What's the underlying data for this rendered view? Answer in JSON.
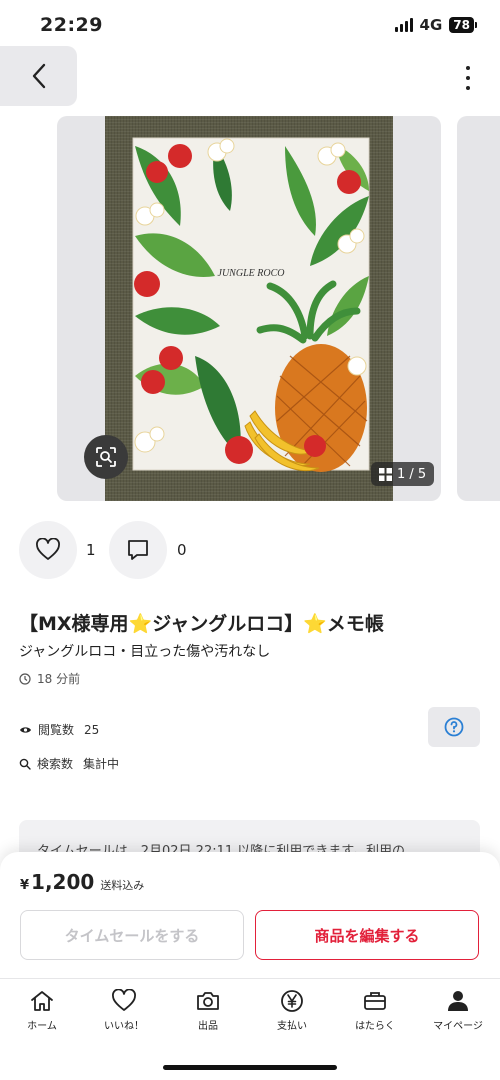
{
  "status_bar": {
    "time": "22:29",
    "network": "4G",
    "battery": "78"
  },
  "carousel": {
    "counter": "1 / 5",
    "photo_text": "JUNGLE ROCO"
  },
  "actions": {
    "like_count": "1",
    "comment_count": "0"
  },
  "item": {
    "title": "【MX様専用⭐️ジャングルロコ】⭐️メモ帳",
    "subtitle": "ジャングルロコ・目立った傷や汚れなし",
    "posted": "18 分前",
    "views_label": "閲覧数",
    "views_value": "25",
    "search_label": "検索数",
    "search_value": "集計中"
  },
  "notice": {
    "text": "タイムセールは、2月02日 22:11 以降に利用できます。利用の"
  },
  "purchase": {
    "currency": "¥",
    "price": "1,200",
    "shipping": "送料込み",
    "timesale_label": "タイムセールをする",
    "edit_label": "商品を編集する"
  },
  "tabs": [
    {
      "label": "ホーム",
      "icon": "home-icon"
    },
    {
      "label": "いいね！",
      "icon": "heart-icon"
    },
    {
      "label": "出品",
      "icon": "camera-icon"
    },
    {
      "label": "支払い",
      "icon": "yen-icon"
    },
    {
      "label": "はたらく",
      "icon": "briefcase-icon"
    },
    {
      "label": "マイページ",
      "icon": "person-icon"
    }
  ],
  "colors": {
    "accent": "#e2203a",
    "help": "#2a7fd4"
  }
}
